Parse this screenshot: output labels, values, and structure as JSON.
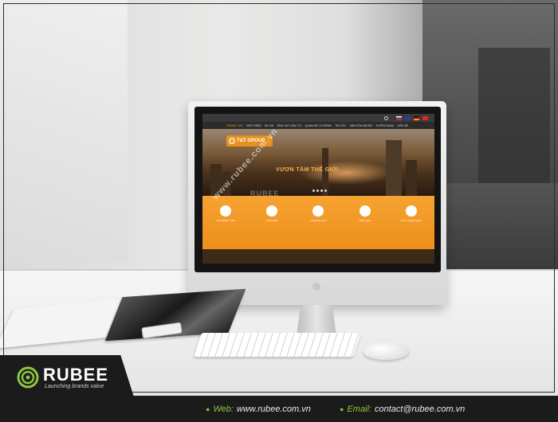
{
  "screen_site": {
    "logo_text": "T&T GROUP",
    "hero_title": "VƯƠN TẦM THẾ GIỚI",
    "nav": [
      "TRANG CHỦ",
      "GIỚI THIỆU",
      "DỰ ÁN",
      "LĨNH VỰC ĐẦU TƯ",
      "QUAN HỆ CỔ ĐÔNG",
      "TIN TỨC",
      "VĂN HÓA NỘI BỘ",
      "TUYỂN DỤNG",
      "LIÊN HỆ"
    ],
    "services": [
      "BẤT ĐỘNG SẢN",
      "TÀI CHÍNH",
      "KHOÁNG SẢN",
      "THỂ THAO",
      "XUẤT NHẬP KHẨU"
    ],
    "watermark": "RUBEE"
  },
  "photo_watermark": "www.rubee.com.vn",
  "brand": {
    "name": "RUBEE",
    "tagline": "Launching brands value",
    "accent": "#8cc63f"
  },
  "footer": {
    "web_label": "Web:",
    "web_value": "www.rubee.com.vn",
    "email_label": "Email:",
    "email_value": "contact@rubee.com.vn"
  }
}
